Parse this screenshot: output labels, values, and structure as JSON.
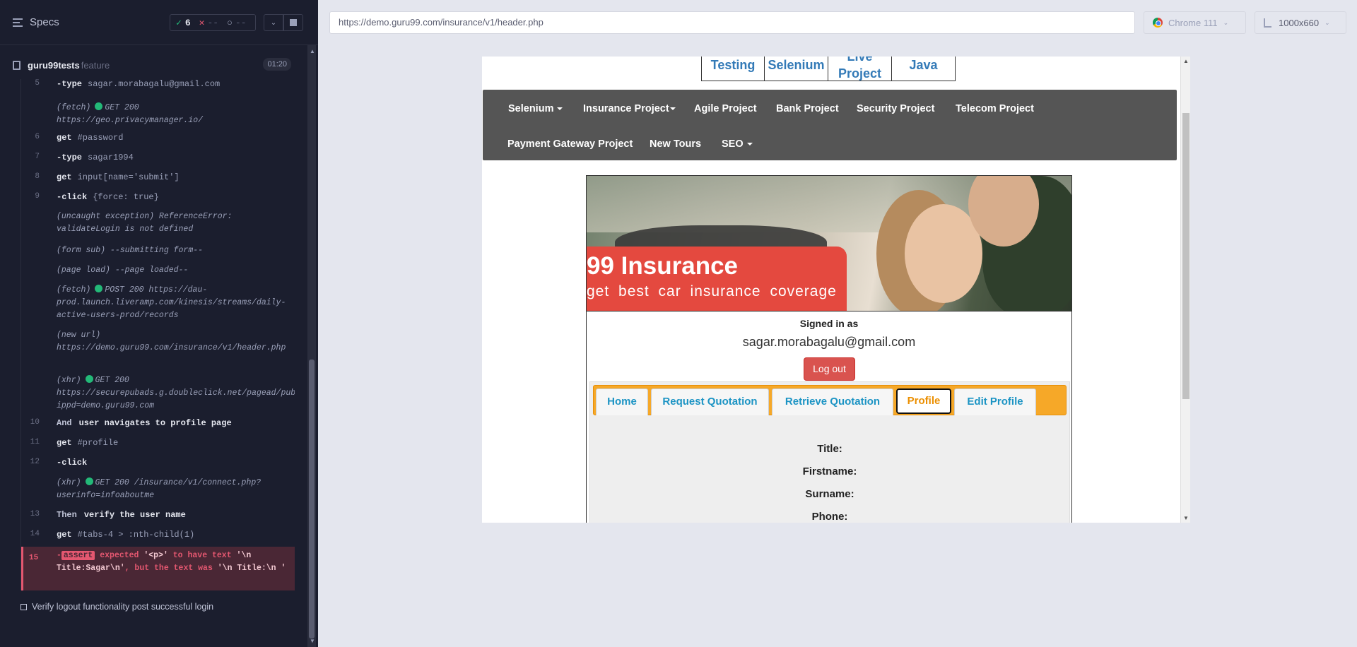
{
  "reporter": {
    "specs_label": "Specs",
    "stats": {
      "passed": "6",
      "failed": "--",
      "pending": "--"
    },
    "spec_name": "guru99tests",
    "spec_ext": "feature",
    "duration": "01:20",
    "log": [
      {
        "num": "5",
        "cmd": "-type",
        "arg": "sagar.morabagalu@gmail.com"
      },
      {
        "sub1": "(fetch)",
        "sub2": "GET 200",
        "sub3": "https://geo.privacymanager.io/"
      },
      {
        "num": "6",
        "cmd": "get",
        "arg": "#password"
      },
      {
        "num": "7",
        "cmd": "-type",
        "arg": "sagar1994"
      },
      {
        "num": "8",
        "cmd": "get",
        "arg": "input[name='submit']"
      },
      {
        "num": "9",
        "cmd": "-click",
        "arg": "{force: true}"
      },
      {
        "text": "(uncaught exception)  ReferenceError: validateLogin is not defined"
      },
      {
        "text": "(form sub)  --submitting form--"
      },
      {
        "text": "(page load)  --page loaded--"
      },
      {
        "sub1": "(fetch)",
        "sub2": "POST 200",
        "sub3": "https://dau-prod.launch.liveramp.com/kinesis/streams/daily-active-users-prod/records"
      },
      {
        "text": "(new url)  https://demo.guru99.com/insurance/v1/header.php"
      },
      {
        "sub1": "(xhr)",
        "sub2": "GET 200",
        "sub3": "https://securepubads.g.doubleclick.net/pagead/pub_config?ippd=demo.guru99.com"
      },
      {
        "num": "10",
        "kw": "And",
        "gher": "user navigates to profile page"
      },
      {
        "num": "11",
        "cmd": "get",
        "arg": "#profile"
      },
      {
        "num": "12",
        "cmd": "-click",
        "arg": ""
      },
      {
        "sub1": "(xhr)",
        "sub2": "GET 200",
        "sub3": "/insurance/v1/connect.php?userinfo=infoaboutme"
      },
      {
        "num": "13",
        "kw": "Then",
        "gher": "verify the user name"
      },
      {
        "num": "14",
        "cmd": "get",
        "arg": "#tabs-4 > :nth-child(1)"
      }
    ],
    "error": {
      "num": "15",
      "prefix": "-",
      "badge": "assert",
      "t1": "expected",
      "t2": "'<p>'",
      "t3": "to have text",
      "t4": "'\\n Title:Sagar\\n'",
      "t5": ", but the text was",
      "t6": "'\\n Title:\\n   '"
    },
    "next_spec": "Verify logout functionality post successful login"
  },
  "preview": {
    "url": "https://demo.guru99.com/insurance/v1/header.php",
    "browser": "Chrome 111",
    "viewport": "1000x660"
  },
  "aut": {
    "top_boxes": [
      "Testing",
      "Selenium",
      "Live Project",
      "Java"
    ],
    "nav": [
      {
        "label": "Selenium",
        "caret": true
      },
      {
        "label": "Insurance Project",
        "caret": true
      },
      {
        "label": "Agile Project",
        "caret": false
      },
      {
        "label": "Bank Project",
        "caret": false
      },
      {
        "label": "Security Project",
        "caret": false
      },
      {
        "label": "Telecom Project",
        "caret": false
      },
      {
        "label": "Payment Gateway Project",
        "caret": false
      },
      {
        "label": "New Tours",
        "caret": false
      },
      {
        "label": "SEO",
        "caret": true
      }
    ],
    "banner_title": "99 Insurance",
    "banner_subtitle": "get best car insurance coverage",
    "signed_in_label": "Signed in as",
    "email": "sagar.morabagalu@gmail.com",
    "logout": "Log out",
    "tabs": [
      "Home",
      "Request Quotation",
      "Retrieve Quotation",
      "Profile",
      "Edit Profile"
    ],
    "active_tab": "Profile",
    "fields": [
      "Title:",
      "Firstname:",
      "Surname:",
      "Phone:"
    ]
  }
}
